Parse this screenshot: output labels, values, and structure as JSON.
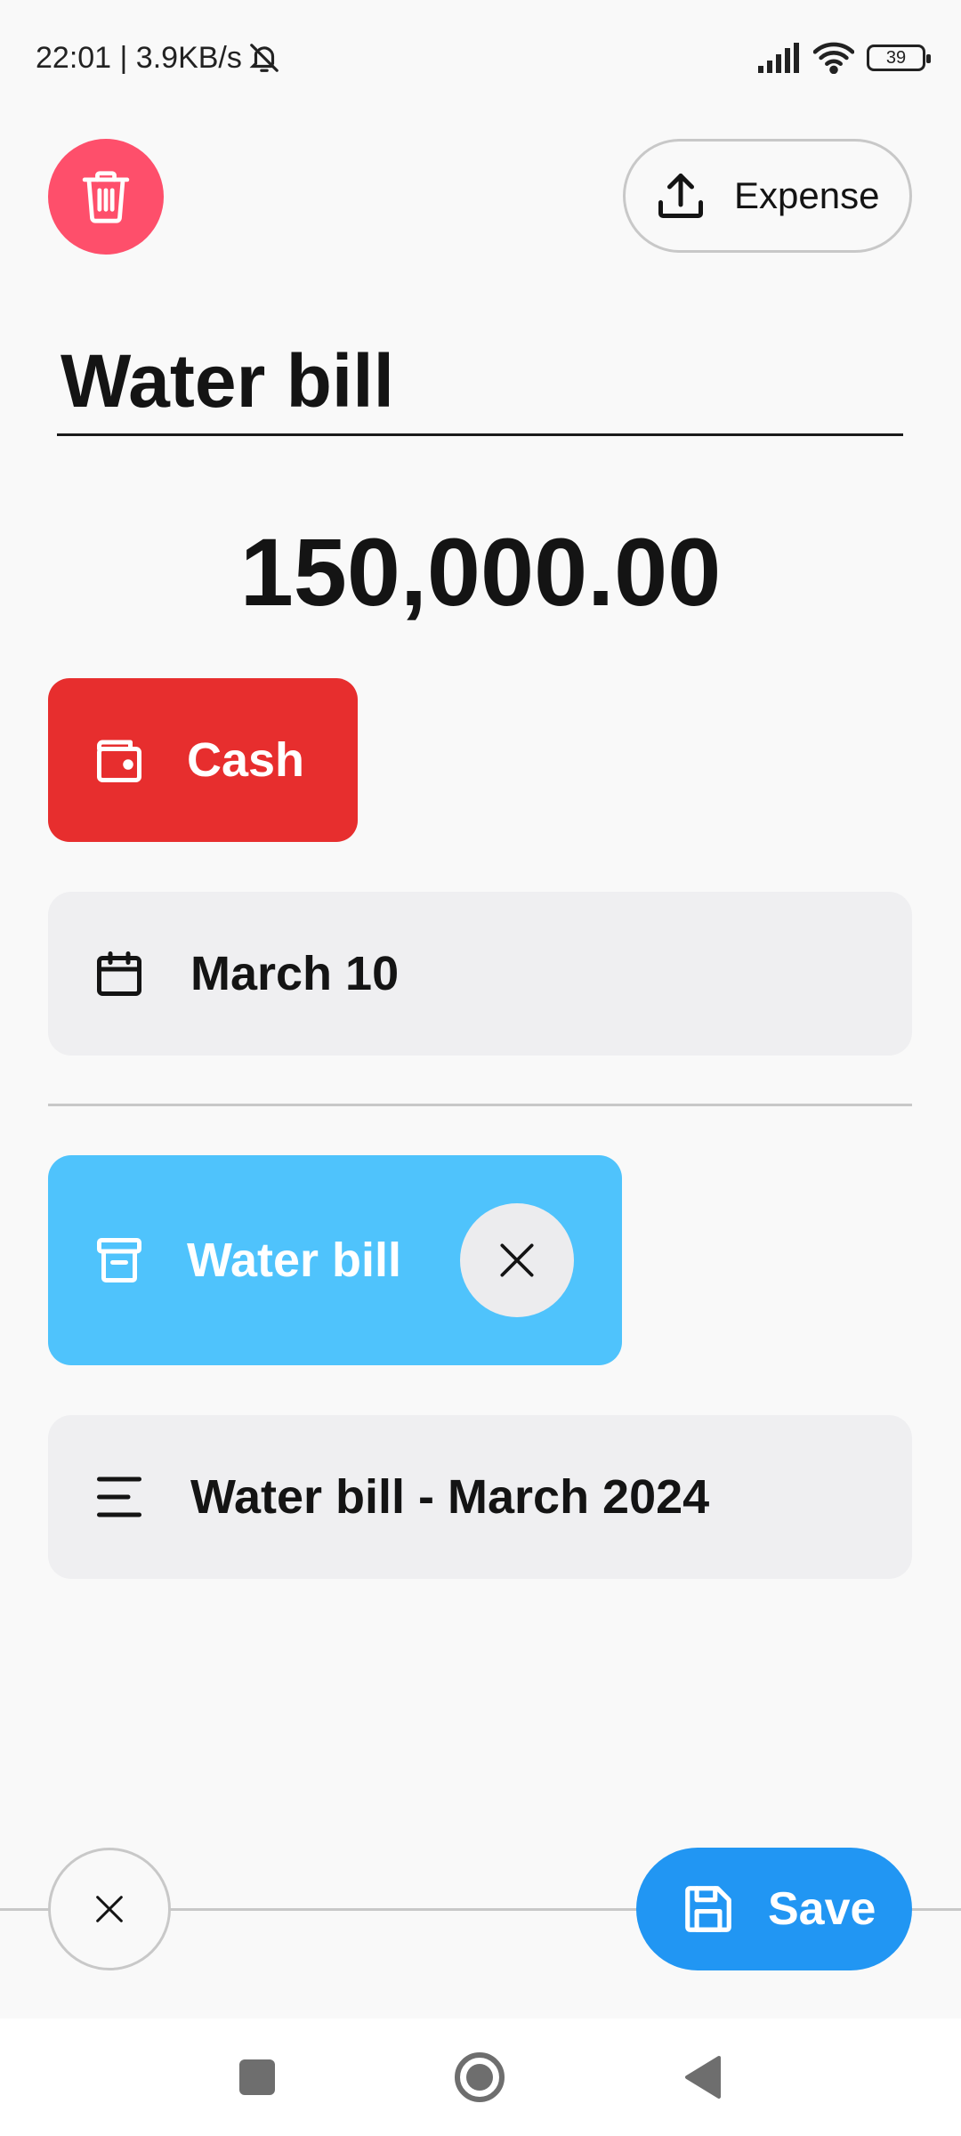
{
  "status_bar": {
    "time_speed": "22:01 | 3.9KB/s",
    "battery": "39",
    "icons": [
      "mute-icon",
      "signal-icon",
      "wifi-icon",
      "battery-icon"
    ]
  },
  "header": {
    "delete_icon": "trash-icon",
    "type_label": "Expense",
    "type_icon": "upload-icon"
  },
  "transaction": {
    "title": "Water bill",
    "amount": "150,000.00"
  },
  "account": {
    "label": "Cash",
    "icon": "wallet-icon",
    "color": "#e72e2e"
  },
  "date": {
    "label": "March 10",
    "icon": "calendar-icon"
  },
  "category": {
    "label": "Water bill",
    "icon": "archive-box-icon",
    "color": "#4fc3fc"
  },
  "note": {
    "label": "Water bill - March 2024",
    "icon": "text-lines-icon"
  },
  "actions": {
    "save_label": "Save",
    "save_color": "#2196f3",
    "delete_color": "#fe4f6b"
  },
  "nav": [
    "recents-square-icon",
    "home-circle-icon",
    "back-triangle-icon"
  ]
}
